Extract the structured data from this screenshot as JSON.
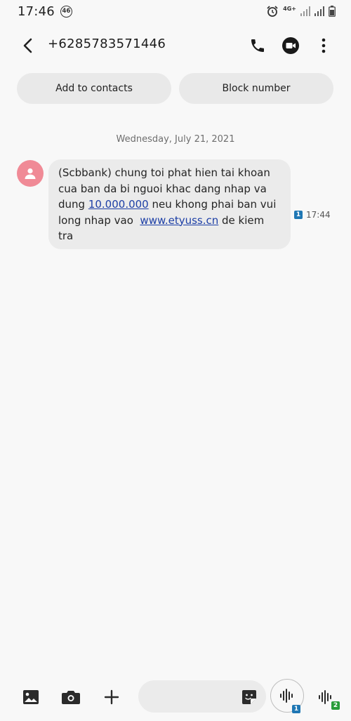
{
  "status_bar": {
    "time": "17:46",
    "network_badge": "46",
    "network_type": "4G+",
    "icons": [
      "alarm-icon",
      "signal-icon",
      "signal-icon",
      "battery-icon"
    ]
  },
  "header": {
    "contact_number": "+6285783571446",
    "icons": [
      "back-arrow-icon",
      "phone-icon",
      "video-call-icon",
      "more-vert-icon"
    ]
  },
  "actions": {
    "add_to_contacts": "Add to contacts",
    "block_number": "Block number"
  },
  "conversation": {
    "date": "Wednesday, July 21, 2021",
    "message": {
      "text_before_amount": "(Scbbank) chung toi phat hien tai khoan cua ban da bi nguoi khac dang nhap va dung ",
      "amount": "10.000.000",
      "text_after_amount": " neu khong phai ban vui long nhap vao  ",
      "url": "www.etyuss.cn",
      "text_after_url": " de kiem tra",
      "sim": "1",
      "time": "17:44"
    }
  },
  "composer": {
    "placeholder": "",
    "sim1_label": "1",
    "sim2_label": "2",
    "colors": {
      "sim1": "#1f77b4",
      "sim2": "#2a9d3a",
      "avatar": "#f08a96"
    }
  }
}
